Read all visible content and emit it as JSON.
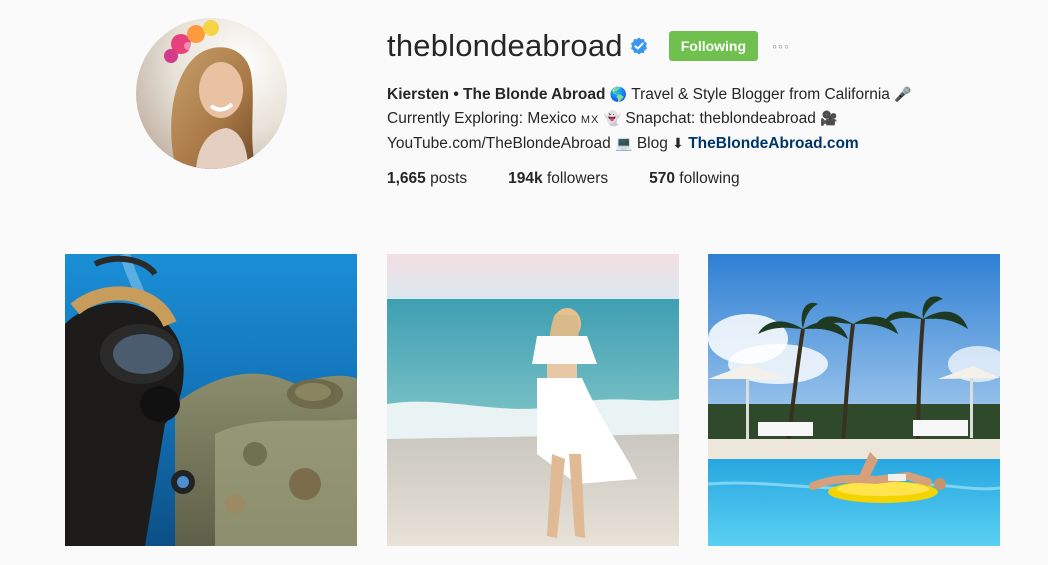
{
  "profile": {
    "username": "theblondeabroad",
    "verified_icon": "verified-badge-icon",
    "follow_label": "Following",
    "more_label": "◦◦◦",
    "accent_color": "#70c050",
    "link_color": "#003569"
  },
  "bio": {
    "name": "Kiersten • The Blonde Abroad",
    "line1_emoji1": "🌎",
    "line1_text": " Travel & Style Blogger from California ",
    "line1_emoji2": "🎤",
    "line2_text_a": "Currently Exploring: Mexico ",
    "line2_flag": "MX",
    "line2_emoji": "👻",
    "line2_text_b": " Snapchat: theblondeabroad ",
    "line2_emoji2": "🎥",
    "line3_text": "YouTube.com/TheBlondeAbroad ",
    "line3_emoji": "💻",
    "line3_text_b": " Blog ",
    "line3_arrow": "⬇",
    "line3_link": "TheBlondeAbroad.com"
  },
  "stats": {
    "posts_value": "1,665",
    "posts_label": " posts",
    "followers_value": "194k",
    "followers_label": " followers",
    "following_value": "570",
    "following_label": " following"
  },
  "posts": [
    {
      "subject": "scuba diving selfie with sea turtle"
    },
    {
      "subject": "woman in white dress on beach"
    },
    {
      "subject": "woman on yellow float in pool with palm trees"
    }
  ]
}
